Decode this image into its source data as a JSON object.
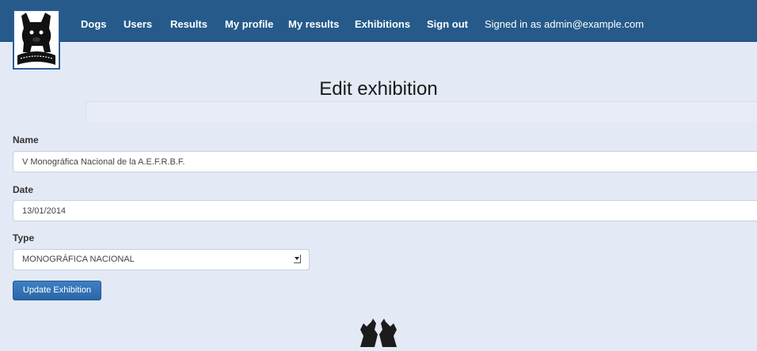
{
  "nav": {
    "items": [
      {
        "label": "Dogs"
      },
      {
        "label": "Users"
      },
      {
        "label": "Results"
      },
      {
        "label": "My profile"
      },
      {
        "label": "My results"
      },
      {
        "label": "Exhibitions"
      },
      {
        "label": "Sign out"
      }
    ],
    "signed_in": "Signed in as admin@example.com"
  },
  "page": {
    "title": "Edit exhibition"
  },
  "form": {
    "name_label": "Name",
    "name_value": "V Monográfica Nacional de la A.E.F.R.B.F.",
    "date_label": "Date",
    "date_value": "13/01/2014",
    "type_label": "Type",
    "type_value": "MONOGRÁFICA NACIONAL",
    "submit_label": "Update Exhibition"
  },
  "colors": {
    "navbar": "#255a8a",
    "background": "#e3e9f5",
    "button": "#2f6fb3"
  },
  "icons": {
    "logo": "french-bulldog-logo-icon",
    "footer": "two-bulldogs-icon"
  }
}
